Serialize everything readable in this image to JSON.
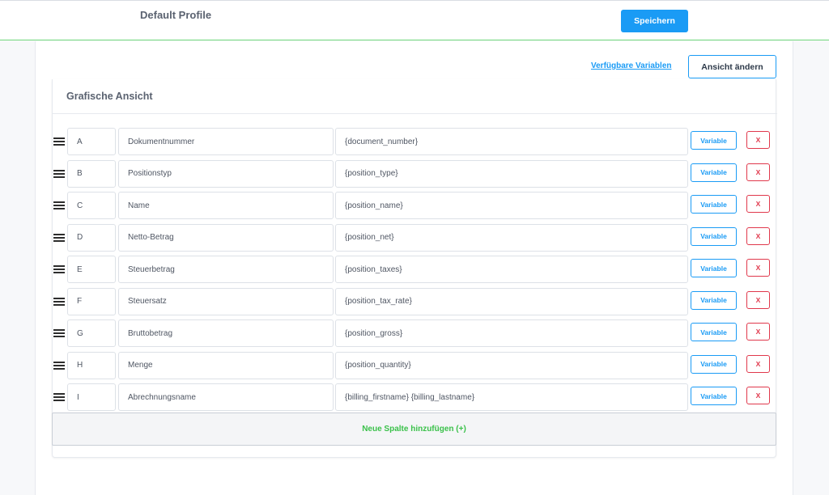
{
  "header": {
    "profile_title": "Default Profile",
    "save_label": "Speichern"
  },
  "toolbar": {
    "variables_link": "Verfügbare Variablen",
    "change_view_label": "Ansicht ändern"
  },
  "card": {
    "title": "Grafische Ansicht"
  },
  "rows": [
    {
      "letter": "A",
      "name": "Dokumentnummer",
      "value": "{document_number}",
      "variable_label": "Variable",
      "delete_label": "X"
    },
    {
      "letter": "B",
      "name": "Positionstyp",
      "value": "{position_type}",
      "variable_label": "Variable",
      "delete_label": "X"
    },
    {
      "letter": "C",
      "name": "Name",
      "value": "{position_name}",
      "variable_label": "Variable",
      "delete_label": "X"
    },
    {
      "letter": "D",
      "name": "Netto-Betrag",
      "value": "{position_net}",
      "variable_label": "Variable",
      "delete_label": "X"
    },
    {
      "letter": "E",
      "name": "Steuerbetrag",
      "value": "{position_taxes}",
      "variable_label": "Variable",
      "delete_label": "X"
    },
    {
      "letter": "F",
      "name": "Steuersatz",
      "value": "{position_tax_rate}",
      "variable_label": "Variable",
      "delete_label": "X"
    },
    {
      "letter": "G",
      "name": "Bruttobetrag",
      "value": "{position_gross}",
      "variable_label": "Variable",
      "delete_label": "X"
    },
    {
      "letter": "H",
      "name": "Menge",
      "value": "{position_quantity}",
      "variable_label": "Variable",
      "delete_label": "X"
    },
    {
      "letter": "I",
      "name": "Abrechnungsname",
      "value": "{billing_firstname} {billing_lastname}",
      "variable_label": "Variable",
      "delete_label": "X"
    }
  ],
  "add_column_label": "Neue Spalte hinzufügen (+)",
  "colors": {
    "accent": "#1a9bf5",
    "danger": "#e0384c",
    "success": "#3ac14a"
  }
}
